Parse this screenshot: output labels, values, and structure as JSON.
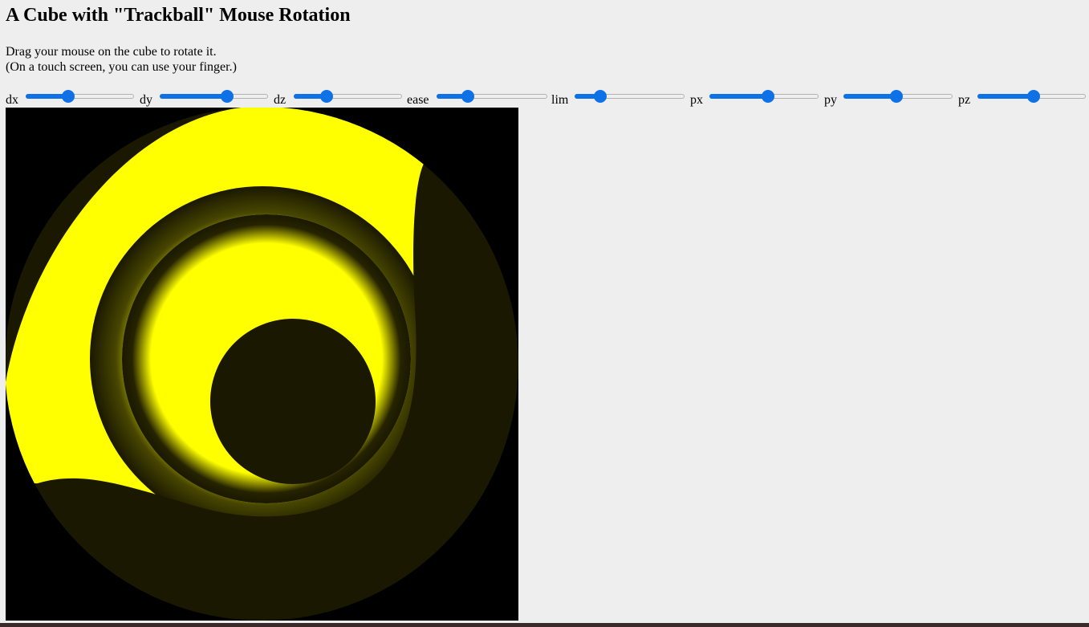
{
  "title": "A Cube with \"Trackball\" Mouse Rotation",
  "instructions": [
    "Drag your mouse on the cube to rotate it.",
    "(On a touch screen, you can use your finger.)"
  ],
  "controls": [
    {
      "label": "dx",
      "value": 0.38
    },
    {
      "label": "dy",
      "value": 0.64
    },
    {
      "label": "dz",
      "value": 0.28
    },
    {
      "label": "ease",
      "value": 0.25
    },
    {
      "label": "lim",
      "value": 0.2
    },
    {
      "label": "px",
      "value": 0.54
    },
    {
      "label": "py",
      "value": 0.48
    },
    {
      "label": "pz",
      "value": 0.52
    }
  ],
  "colors": {
    "face": "#ffff00",
    "dark_face": "#1a1800",
    "accent": "#0f71e6"
  }
}
